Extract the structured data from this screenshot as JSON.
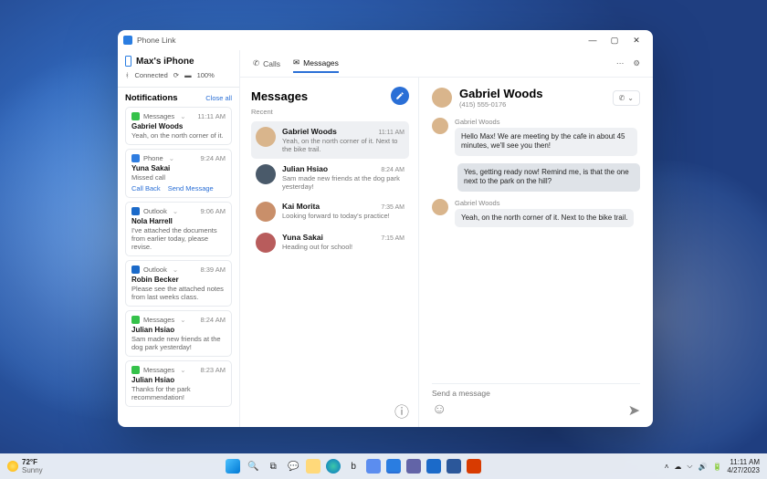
{
  "app": {
    "title": "Phone Link"
  },
  "device": {
    "name": "Max's iPhone",
    "bt_label": "Connected",
    "battery_label": "100%"
  },
  "notifications": {
    "heading": "Notifications",
    "close_all": "Close all",
    "items": [
      {
        "app": "Messages",
        "appclass": "msg",
        "time": "11:11 AM",
        "title": "Gabriel Woods",
        "body": "Yeah, on the north corner of it."
      },
      {
        "app": "Phone",
        "appclass": "phone",
        "time": "9:24 AM",
        "title": "Yuna Sakai",
        "body": "Missed call",
        "actions": [
          "Call Back",
          "Send Message"
        ]
      },
      {
        "app": "Outlook",
        "appclass": "outlook",
        "time": "9:06 AM",
        "title": "Nola Harrell",
        "body": "I've attached the documents from earlier today, please revise."
      },
      {
        "app": "Outlook",
        "appclass": "outlook",
        "time": "8:39 AM",
        "title": "Robin Becker",
        "body": "Please see the attached notes from last weeks class."
      },
      {
        "app": "Messages",
        "appclass": "msg",
        "time": "8:24 AM",
        "title": "Julian Hsiao",
        "body": "Sam made new friends at the dog park yesterday!"
      },
      {
        "app": "Messages",
        "appclass": "msg",
        "time": "8:23 AM",
        "title": "Julian Hsiao",
        "body": "Thanks for the park recommendation!"
      }
    ]
  },
  "tabs": {
    "calls": "Calls",
    "messages": "Messages"
  },
  "conversations": {
    "heading": "Messages",
    "recent_label": "Recent",
    "items": [
      {
        "name": "Gabriel Woods",
        "time": "11:11 AM",
        "preview": "Yeah, on the north corner of it. Next to the bike trail.",
        "avatar": "#d9b58c",
        "selected": true
      },
      {
        "name": "Julian Hsiao",
        "time": "8:24 AM",
        "preview": "Sam made new friends at the dog park yesterday!",
        "avatar": "#4a5a6a"
      },
      {
        "name": "Kai Morita",
        "time": "7:35 AM",
        "preview": "Looking forward to today's practice!",
        "avatar": "#c98f6a"
      },
      {
        "name": "Yuna Sakai",
        "time": "7:15 AM",
        "preview": "Heading out for school!",
        "avatar": "#b85c5c"
      }
    ]
  },
  "chat": {
    "name": "Gabriel Woods",
    "phone": "(415) 555-0176",
    "avatar": "#d9b58c",
    "messages": [
      {
        "dir": "in",
        "sender": "Gabriel Woods",
        "text": "Hello Max! We are meeting by the cafe in about 45 minutes, we'll see you then!"
      },
      {
        "dir": "out",
        "text": "Yes, getting ready now! Remind me, is that the one next to the park on the hill?"
      },
      {
        "dir": "in",
        "sender": "Gabriel Woods",
        "text": "Yeah, on the north corner of it. Next to the bike trail."
      }
    ],
    "composer_placeholder": "Send a message"
  },
  "taskbar": {
    "weather_temp": "72°F",
    "weather_cond": "Sunny",
    "time": "11:11 AM",
    "date": "4/27/2023"
  }
}
